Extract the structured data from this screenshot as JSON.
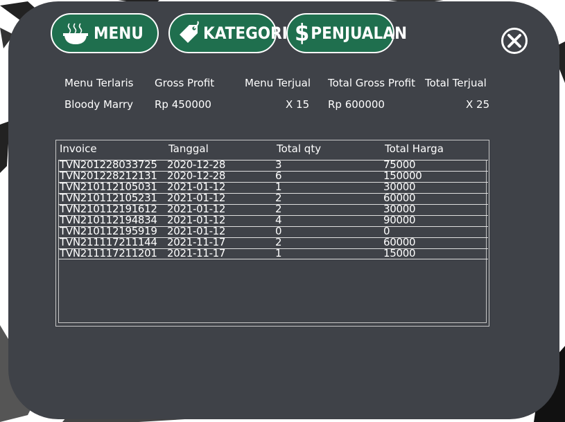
{
  "nav": {
    "menu_label": "MENU",
    "kategori_label": "KATEGORI",
    "penjualan_label": "PENJUALAN",
    "penjualan_symbol": "$"
  },
  "summary": {
    "headers": {
      "menu_terlaris": "Menu Terlaris",
      "gross_profit": "Gross Profit",
      "menu_terjual": "Menu Terjual",
      "total_gross_profit": "Total Gross Profit",
      "total_terjual": "Total Terjual"
    },
    "values": {
      "menu_terlaris": "Bloody Marry",
      "gross_profit": "Rp  450000",
      "menu_terjual": "X  15",
      "total_gross_profit": "Rp  600000",
      "total_terjual": "X  25"
    }
  },
  "table": {
    "columns": [
      "Invoice",
      "Tanggal",
      "Total qty",
      "Total Harga"
    ],
    "rows": [
      [
        "TVN201228033725",
        "2020-12-28",
        "3",
        "75000"
      ],
      [
        "TVN201228212131",
        "2020-12-28",
        "6",
        "150000"
      ],
      [
        "TVN210112105031",
        "2021-01-12",
        "1",
        "30000"
      ],
      [
        "TVN210112105231",
        "2021-01-12",
        "2",
        "60000"
      ],
      [
        "TVN210112191612",
        "2021-01-12",
        "2",
        "30000"
      ],
      [
        "TVN210112194834",
        "2021-01-12",
        "4",
        "90000"
      ],
      [
        "TVN210112195919",
        "2021-01-12",
        "0",
        "0"
      ],
      [
        "TVN211117211144",
        "2021-11-17",
        "2",
        "60000"
      ],
      [
        "TVN211117211201",
        "2021-11-17",
        "1",
        "15000"
      ]
    ]
  },
  "colors": {
    "panel": "#3f4248",
    "nav_button": "#1f6f4e",
    "text": "#ffffff"
  },
  "icons": {
    "menu": "bowl-icon",
    "kategori": "tag-icon",
    "penjualan": "dollar-icon",
    "close": "close-icon"
  }
}
